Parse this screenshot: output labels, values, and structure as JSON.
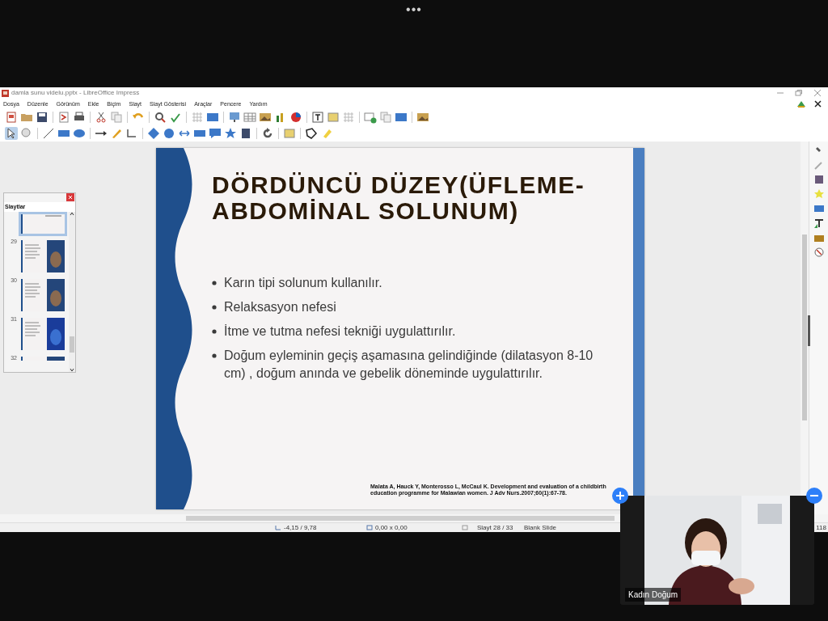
{
  "meeting": {
    "more_menu": "•••"
  },
  "window": {
    "title": "damla sunu videlu.pptx - LibreOffice Impress"
  },
  "menu": [
    "Dosya",
    "Düzenle",
    "Görünüm",
    "Ekle",
    "Biçim",
    "Slayt",
    "Slayt Gösterisi",
    "Araçlar",
    "Pencere",
    "Yardım"
  ],
  "slides_panel": {
    "title": "Slaytlar",
    "slides": [
      {
        "selected": true
      },
      {
        "number": "29",
        "selected": false
      },
      {
        "number": "30",
        "selected": false
      },
      {
        "number": "31",
        "selected": false
      },
      {
        "number": "32",
        "selected": false
      }
    ]
  },
  "slide": {
    "title": "DÖRDÜNCÜ DÜZEY(ÜFLEME-ABDOMİNAL SOLUNUM)",
    "bullets": [
      "Karın tipi solunum kullanılır.",
      "Relaksasyon nefesi",
      "İtme ve tutma nefesi tekniği uygulattırılır.",
      "Doğum eyleminin geçiş aşamasına gelindiğinde (dilatasyon 8-10 cm) , doğum anında ve gebelik döneminde uygulattırılır."
    ],
    "citation": "Malata A, Hauck Y, Monterosso L, McCaul K. Development and evaluation of a childbirth education programme for Malawian women. J Adv Nurs.2007;60(1):67-78."
  },
  "status_bar": {
    "position": "-4,15 / 9,78",
    "size": "0,00 x 0,00",
    "slide": "Slayt 28 / 33",
    "layout": "Blank Slide",
    "zoom": "118"
  },
  "video": {
    "name": "Kadın Doğum"
  }
}
